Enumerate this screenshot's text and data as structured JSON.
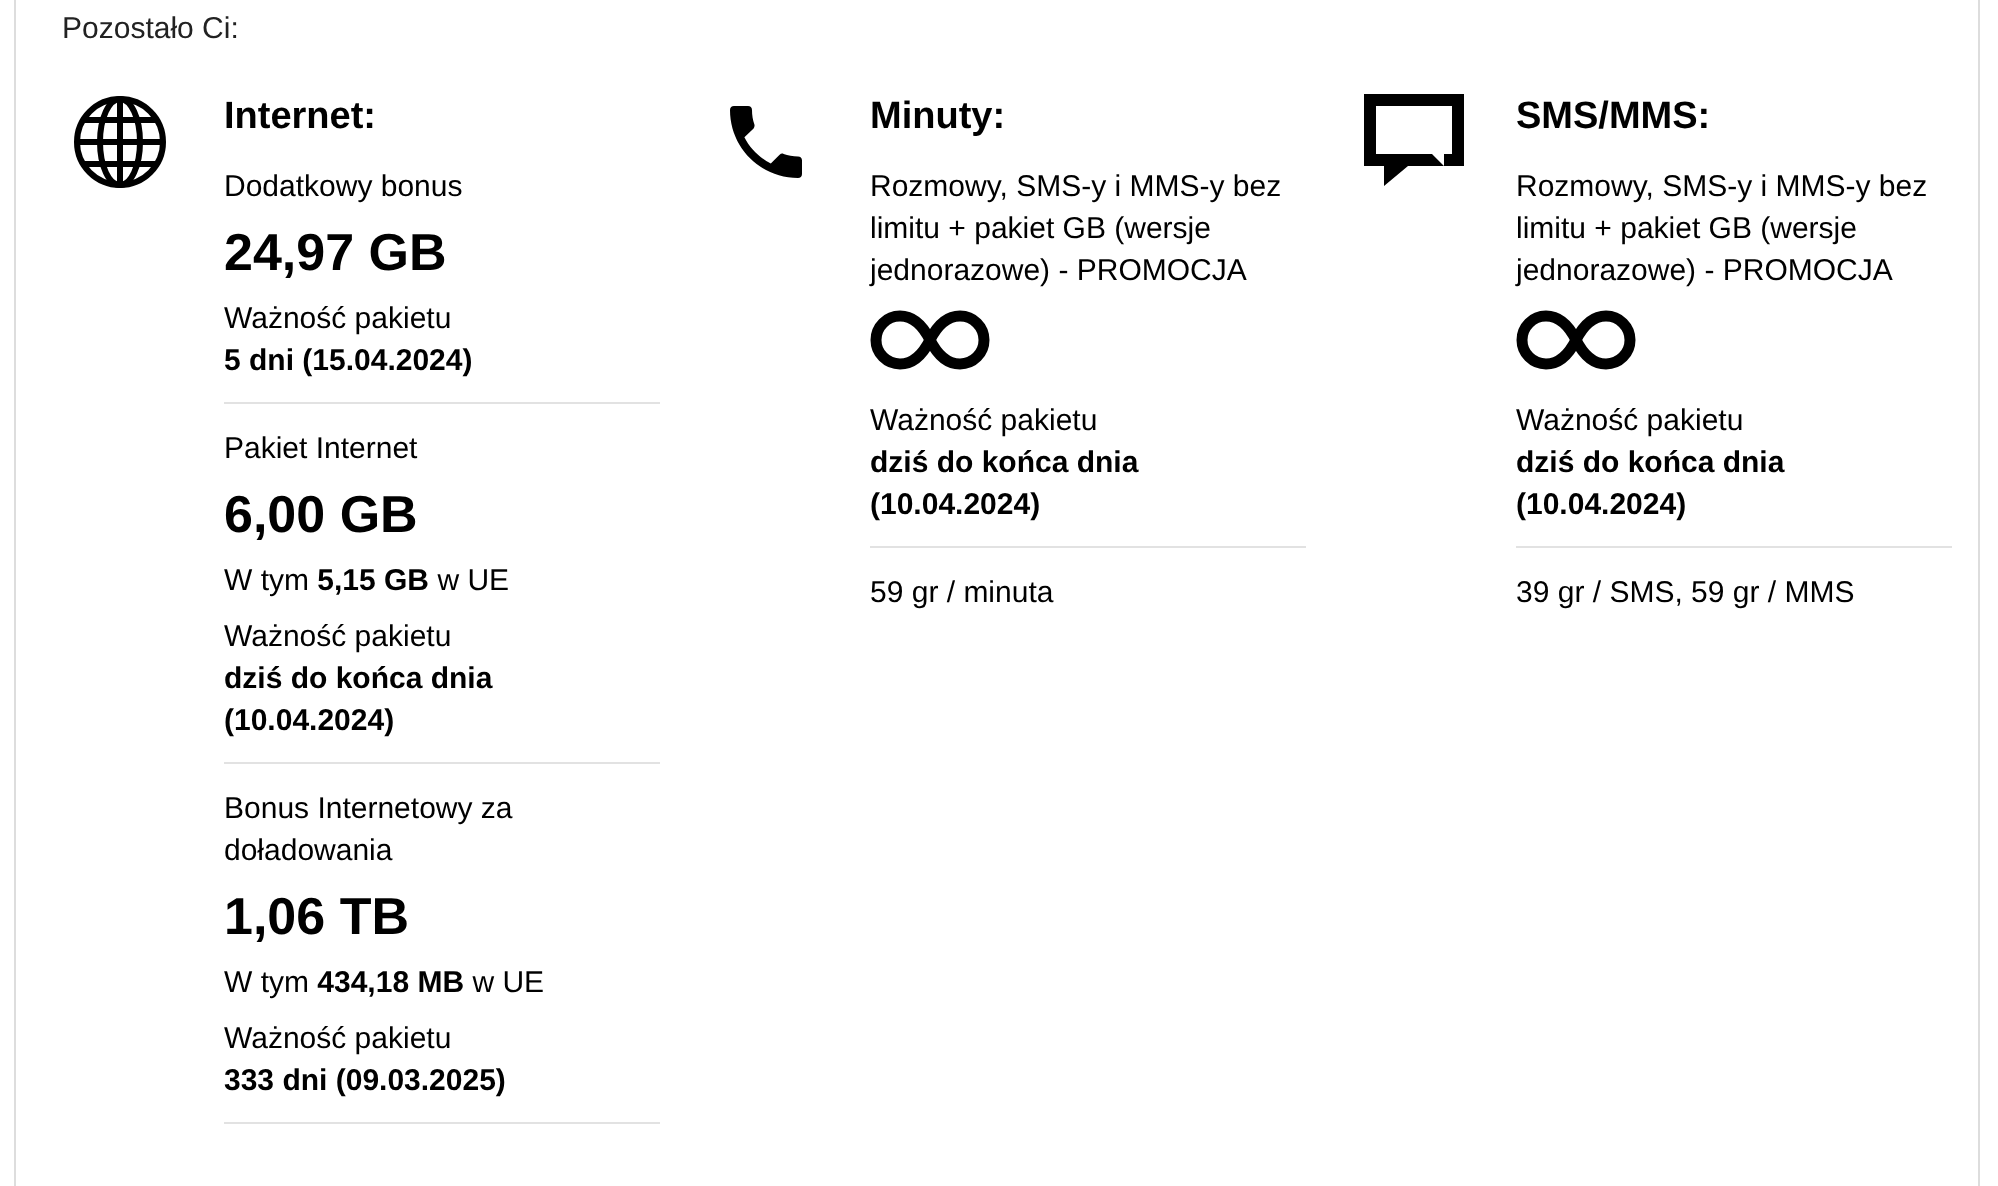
{
  "heading": "Pozostało Ci:",
  "sections": [
    {
      "kind": "internet",
      "title": "Internet:",
      "packages": [
        {
          "name": "Dodatkowy bonus",
          "amount": "24,97 GB",
          "validity_label": "Ważność pakietu",
          "validity": "5 dni (15.04.2024)"
        },
        {
          "name": "Pakiet Internet",
          "amount": "6,00 GB",
          "eu_note": "W tym **5,15 GB** w UE",
          "validity_label": "Ważność pakietu",
          "validity": "dziś do końca dnia (10.04.2024)"
        },
        {
          "name": "Bonus Internetowy za doładowania",
          "amount": "1,06 TB",
          "eu_note": "W tym **434,18 MB** w UE",
          "validity_label": "Ważność pakietu",
          "validity": "333 dni (09.03.2025)"
        }
      ]
    },
    {
      "kind": "calls",
      "title": "Minuty:",
      "description": "Rozmowy, SMS-y i MMS-y bez limitu + pakiet GB (wersje jednorazowe) - PROMOCJA",
      "unlimited": true,
      "validity_label": "Ważność pakietu",
      "validity": "dziś do końca dnia (10.04.2024)",
      "price": "59 gr / minuta"
    },
    {
      "kind": "messages",
      "title": "SMS/MMS:",
      "description": "Rozmowy, SMS-y i MMS-y bez limitu + pakiet GB (wersje jednorazowe) - PROMOCJA",
      "unlimited": true,
      "validity_label": "Ważność pakietu",
      "validity": "dziś do końca dnia (10.04.2024)",
      "price": "39 gr / SMS, 59 gr / MMS"
    }
  ]
}
